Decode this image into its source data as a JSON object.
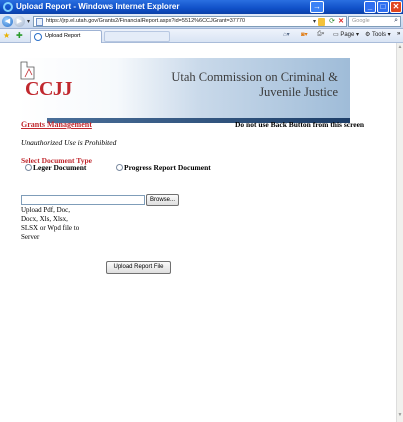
{
  "window": {
    "title": "Upload Report - Windows Internet Explorer"
  },
  "address_bar": {
    "url": "https://jrp.el.utah.gov/Grants2/FinancialReport.aspx?id=5512%6CCJGrant=37770",
    "search_placeholder": "Google"
  },
  "tabs": [
    {
      "label": "Upload Report"
    }
  ],
  "toolbar": {
    "page_label": "Page",
    "tools_label": "Tools"
  },
  "banner": {
    "logo_text": "CCJJ",
    "org_name": "Utah Commission on Criminal & Juvenile Justice"
  },
  "page": {
    "grants_link": "Grants Management",
    "back_warning": "Do not use Back Button from this screen",
    "unauthorized": "Unauthorized Use is Prohibited",
    "doc_type_label": "Select Document Type",
    "radio_ledger": "Leger Document",
    "radio_progress": "Progress Report Document",
    "browse_label": "Browse...",
    "upload_hint": "Upload Pdf, Doc, Docx, Xls, Xlsx, SLSX or Wpd file to Server",
    "upload_button": "Upload Report File"
  }
}
